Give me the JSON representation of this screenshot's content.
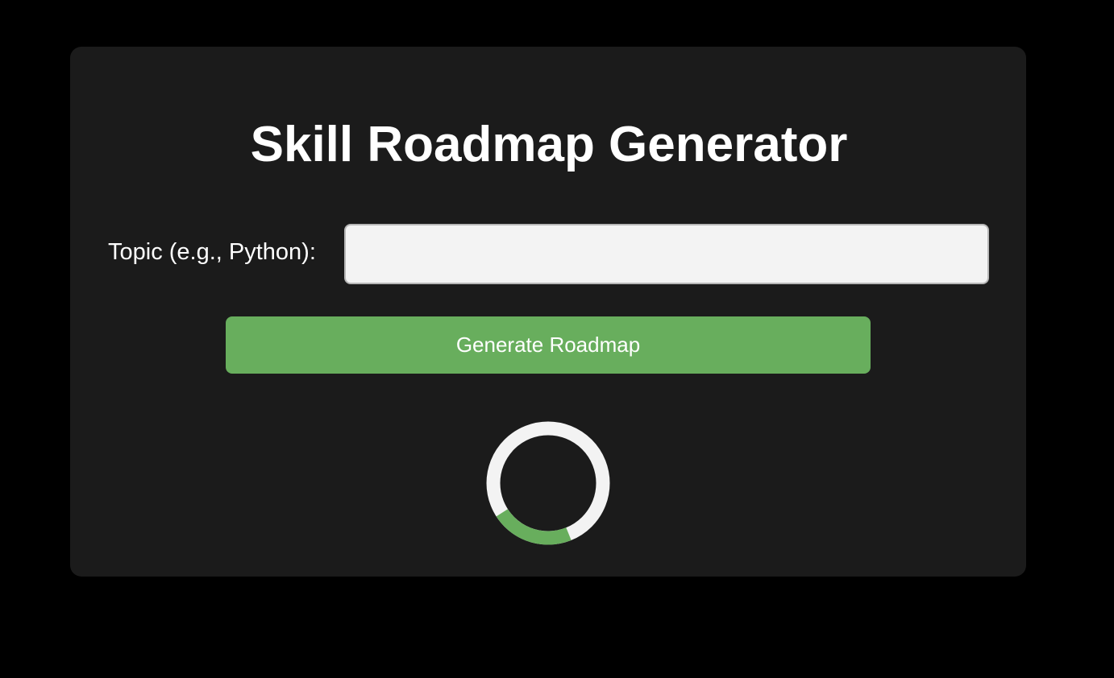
{
  "title": "Skill Roadmap Generator",
  "form": {
    "topic_label": "Topic (e.g., Python):",
    "topic_value": "",
    "generate_label": "Generate Roadmap"
  },
  "spinner": {
    "track_color": "#f3f3f3",
    "accent_color": "#68ae5d",
    "progress_fraction": 0.22
  },
  "colors": {
    "background": "#000000",
    "card": "#1b1b1b",
    "accent": "#68ae5d"
  }
}
